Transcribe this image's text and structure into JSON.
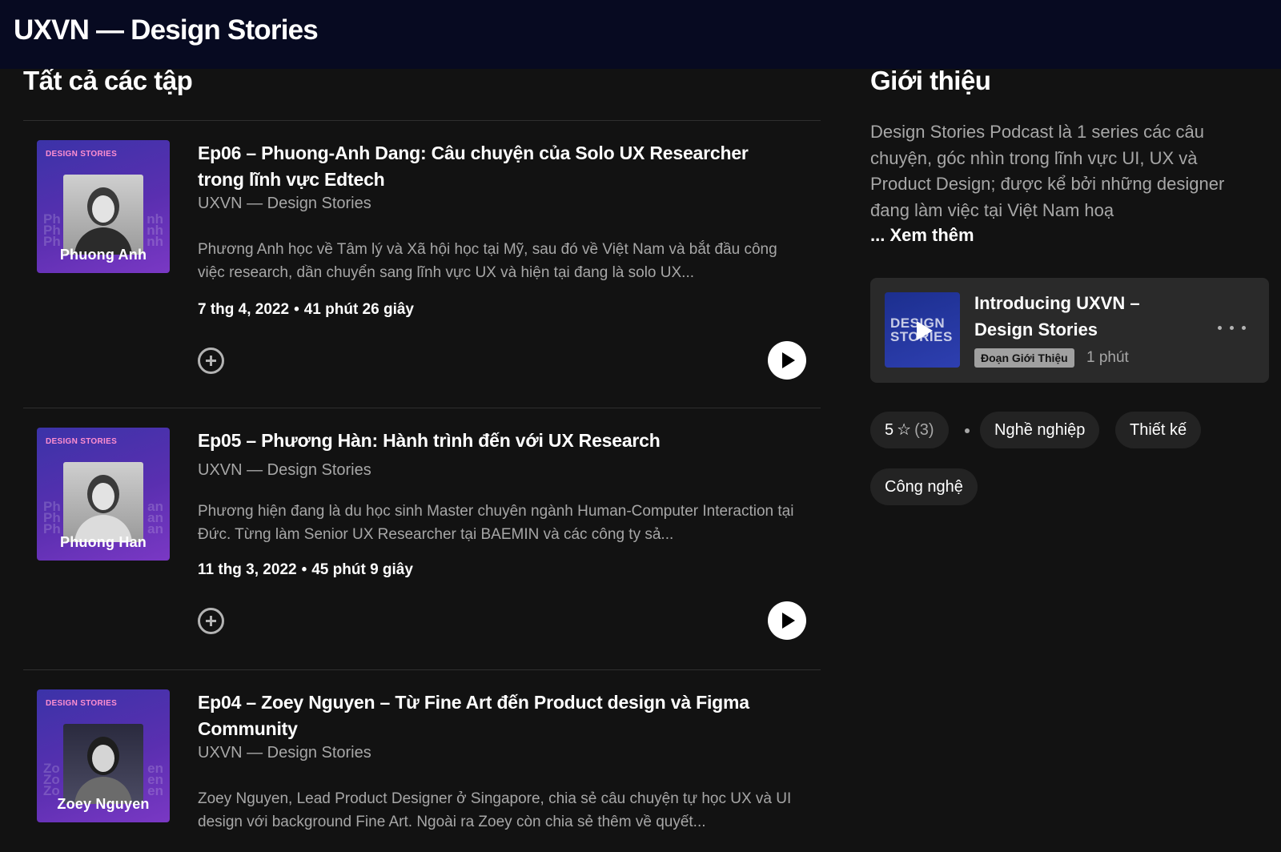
{
  "header": {
    "title": "UXVN — Design Stories"
  },
  "episodes_section": {
    "title": "Tất cả các tập"
  },
  "about_section": {
    "title": "Giới thiệu",
    "description": "Design Stories Podcast là 1 series các câu chuyện, góc nhìn trong lĩnh vực UI, UX và Product Design; được kể bởi những designer đang làm việc tại Việt Nam hoạ",
    "see_more": "... Xem thêm"
  },
  "episodes": [
    {
      "title": "Ep06 – Phuong-Anh Dang: Câu chuyện của Solo UX Researcher trong lĩnh vực Edtech",
      "show": "UXVN — Design Stories",
      "description": "Phương Anh học về Tâm lý và Xã hội học tại Mỹ, sau đó về Việt Nam và bắt đầu công việc research, dần chuyển sang lĩnh vực UX và hiện tại đang là solo UX...",
      "date": "7 thg 4, 2022",
      "duration": "41 phút 26 giây",
      "cover_brand": "DESIGN STORIES",
      "cover_name": "Phuong Anh"
    },
    {
      "title": "Ep05 – Phương Hàn: Hành trình đến với UX Research",
      "show": "UXVN — Design Stories",
      "description": "Phương hiện đang là du học sinh Master chuyên ngành Human-Computer Interaction tại Đức. Từng làm Senior UX Researcher tại BAEMIN và các công ty sả...",
      "date": "11 thg 3, 2022",
      "duration": "45 phút 9 giây",
      "cover_brand": "DESIGN STORIES",
      "cover_name": "Phuong Han"
    },
    {
      "title": "Ep04 – Zoey Nguyen – Từ Fine Art đến Product design và Figma Community",
      "show": "UXVN — Design Stories",
      "description": "Zoey Nguyen, Lead Product Designer ở Singapore, chia sẻ câu chuyện tự học UX và UI design với background Fine Art. Ngoài ra Zoey còn chia sẻ thêm về quyết...",
      "cover_brand": "DESIGN STORIES",
      "cover_name": "Zoey Nguyen"
    }
  ],
  "trailer": {
    "title": "Introducing UXVN – Design Stories",
    "badge": "Đoạn Giới Thiệu",
    "duration": "1 phút",
    "cover_text": "DESIGN STORIES"
  },
  "rating": {
    "value": "5",
    "count": "(3)"
  },
  "tags": [
    "Nghề nghiệp",
    "Thiết kế",
    "Công nghệ"
  ],
  "icons": {
    "add": "add-circle-icon",
    "play": "play-icon",
    "more": "more-horizontal-icon",
    "star": "star-outline-icon"
  },
  "colors": {
    "header_bg": "#070a21",
    "page_bg": "#121212",
    "secondary_text": "#a7a7a7",
    "card_bg": "#2a2a2a"
  }
}
